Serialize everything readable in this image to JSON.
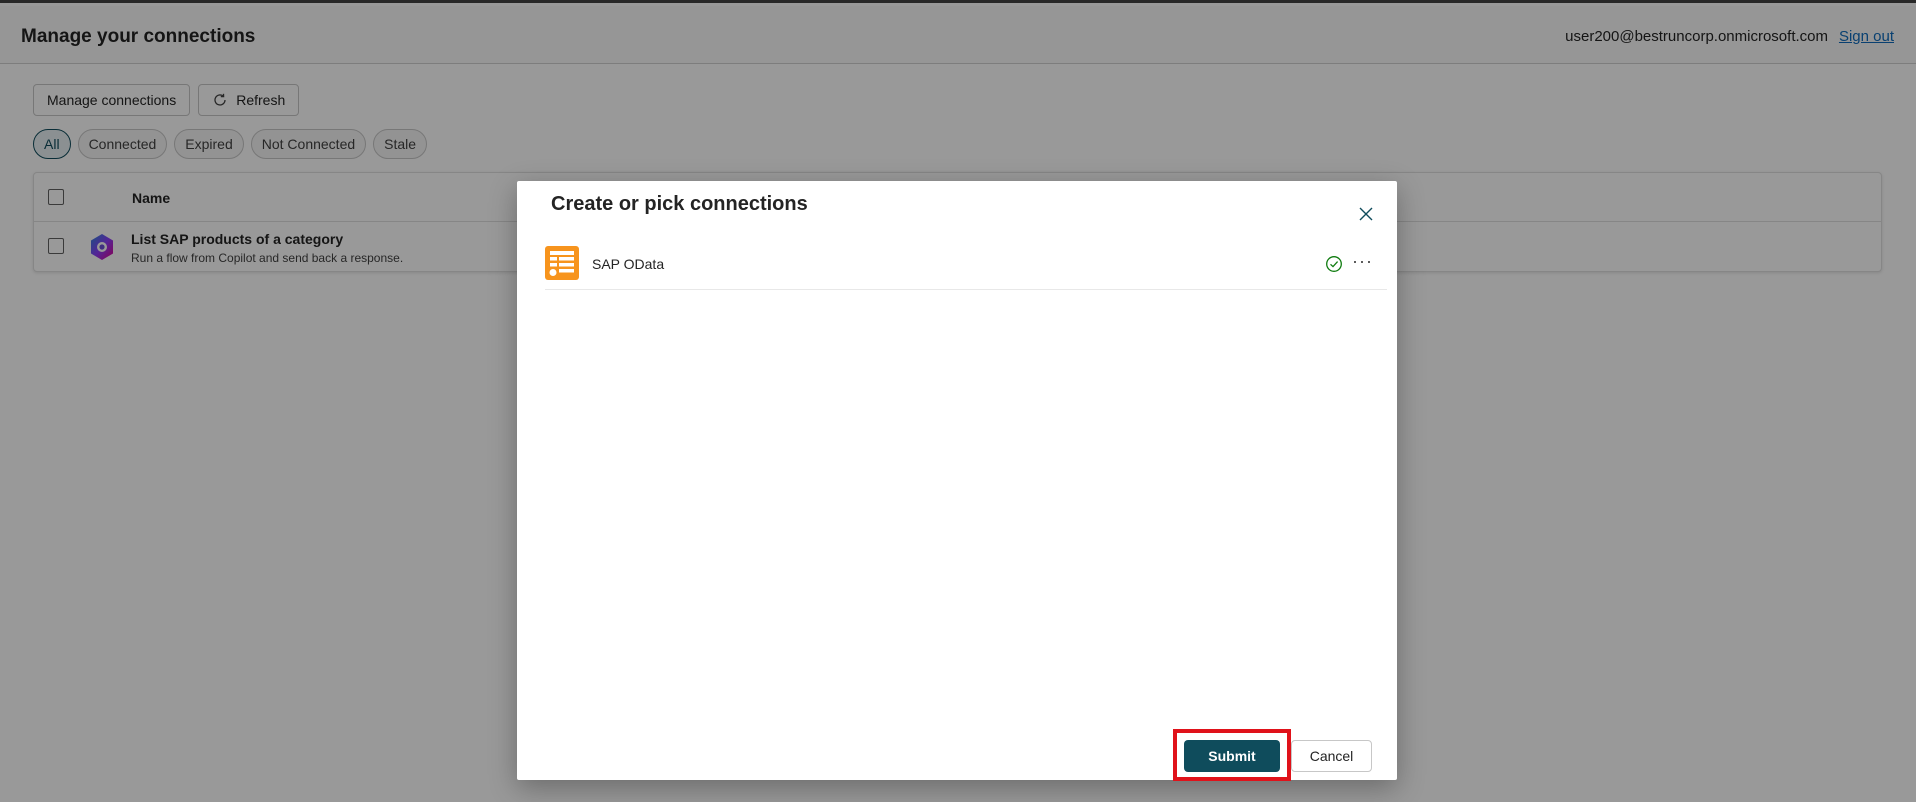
{
  "header": {
    "title": "Manage your connections",
    "user_email": "user200@bestruncorp.onmicrosoft.com",
    "signout_label": "Sign out"
  },
  "toolbar": {
    "manage_label": "Manage connections",
    "refresh_label": "Refresh",
    "refresh_icon": "refresh-icon"
  },
  "filters": [
    {
      "label": "All",
      "active": true
    },
    {
      "label": "Connected",
      "active": false
    },
    {
      "label": "Expired",
      "active": false
    },
    {
      "label": "Not Connected",
      "active": false
    },
    {
      "label": "Stale",
      "active": false
    }
  ],
  "table": {
    "columns": [
      "Name"
    ],
    "rows": [
      {
        "title": "List SAP products of a category",
        "subtitle": "Run a flow from Copilot and send back a response.",
        "icon": "copilot-icon"
      }
    ]
  },
  "dialog": {
    "title": "Create or pick connections",
    "connections": [
      {
        "name": "SAP OData",
        "icon": "sap-odata-icon",
        "status": "connected"
      }
    ],
    "submit_label": "Submit",
    "cancel_label": "Cancel"
  },
  "colors": {
    "accent": "#0f4c5c",
    "link": "#0f6cbd",
    "highlight": "#e0121a",
    "connector_orange": "#f7941d",
    "status_green": "#107c10"
  }
}
